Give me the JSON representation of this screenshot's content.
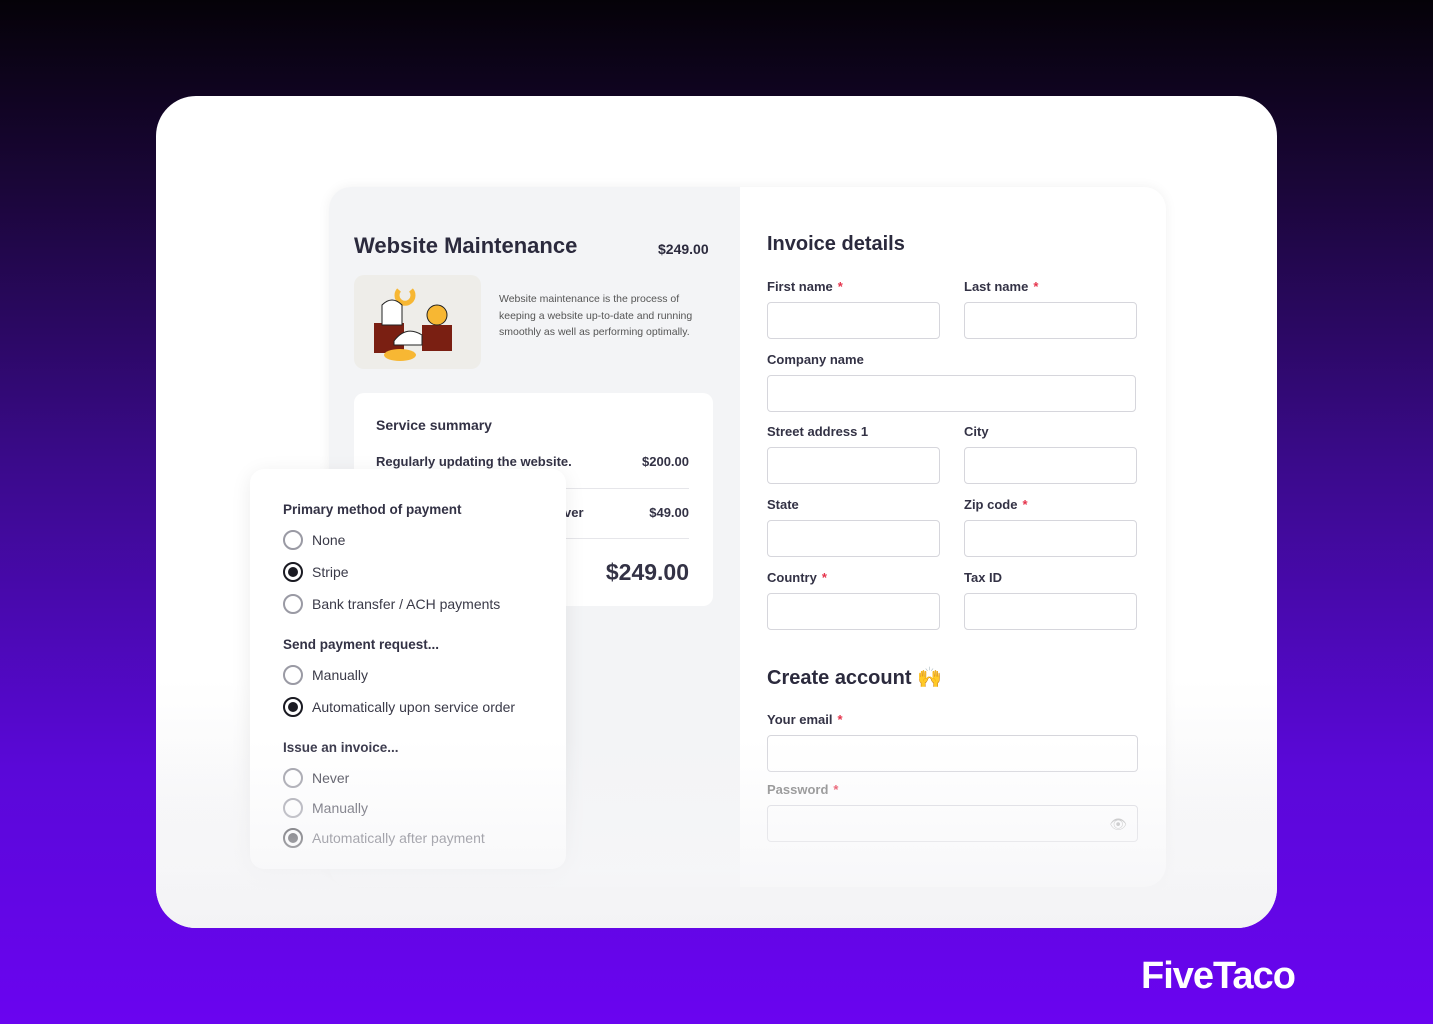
{
  "service": {
    "title": "Website Maintenance",
    "price": "$249.00",
    "description": "Website maintenance is the process of keeping a website up-to-date and running smoothly as well as performing optimally.",
    "summary": {
      "title": "Service summary",
      "items": [
        {
          "label": "Regularly updating the website.",
          "price": "$200.00"
        },
        {
          "label": "ver",
          "price": "$49.00"
        }
      ],
      "total": "$249.00"
    }
  },
  "payment": {
    "primary_title": "Primary method of payment",
    "primary_options": [
      {
        "label": "None",
        "selected": false
      },
      {
        "label": "Stripe",
        "selected": true
      },
      {
        "label": "Bank transfer / ACH payments",
        "selected": false
      }
    ],
    "request_title": "Send payment request...",
    "request_options": [
      {
        "label": "Manually",
        "selected": false
      },
      {
        "label": "Automatically upon service order",
        "selected": true
      }
    ],
    "invoice_title": "Issue an invoice...",
    "invoice_options": [
      {
        "label": "Never",
        "selected": false
      },
      {
        "label": "Manually",
        "selected": false
      },
      {
        "label": "Automatically after payment",
        "selected": true
      }
    ]
  },
  "invoice": {
    "title": "Invoice details",
    "first_name": "First name",
    "last_name": "Last name",
    "company": "Company name",
    "street": "Street address 1",
    "city": "City",
    "state": "State",
    "zip": "Zip code",
    "country": "Country",
    "tax": "Tax ID",
    "required_mark": "*"
  },
  "account": {
    "title": "Create account",
    "emoji": "🙌",
    "email": "Your email",
    "password": "Password"
  },
  "brand": "FiveTaco"
}
